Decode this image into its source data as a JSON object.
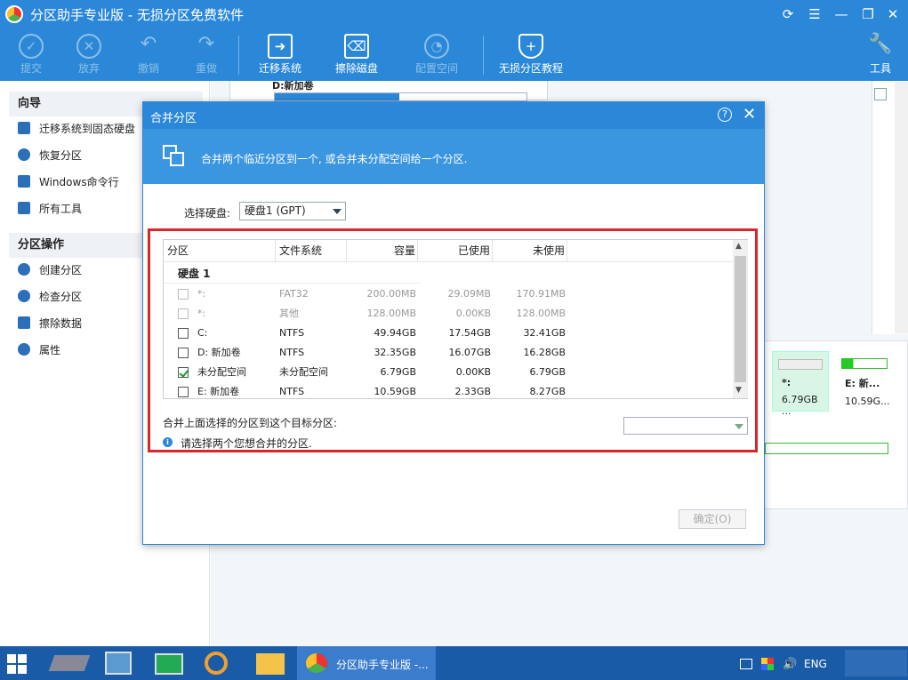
{
  "app": {
    "title": "分区助手专业版 - 无损分区免费软件"
  },
  "toolbar": {
    "items": [
      {
        "label": "提交",
        "icon": "check-icon",
        "disabled": true
      },
      {
        "label": "放弃",
        "icon": "cancel-circle-icon",
        "disabled": true
      },
      {
        "label": "撤销",
        "icon": "undo-icon",
        "disabled": true
      },
      {
        "label": "重做",
        "icon": "redo-icon",
        "disabled": true
      },
      {
        "label": "迁移系统",
        "icon": "migrate-icon",
        "disabled": false
      },
      {
        "label": "擦除磁盘",
        "icon": "wipe-disk-icon",
        "disabled": false
      },
      {
        "label": "配置空间",
        "icon": "allocate-icon",
        "disabled": true
      },
      {
        "label": "无损分区教程",
        "icon": "shield-icon",
        "disabled": false
      },
      {
        "label": "工具",
        "icon": "wrench-icon",
        "disabled": false
      }
    ]
  },
  "sidebar": {
    "wizard_title": "向导",
    "wizard_items": [
      "迁移系统到固态硬盘",
      "恢复分区",
      "Windows命令行",
      "所有工具"
    ],
    "ops_title": "分区操作",
    "ops_items": [
      "创建分区",
      "检查分区",
      "擦除数据",
      "属性"
    ]
  },
  "background": {
    "disk_label": "D:新加卷",
    "cards": [
      {
        "name": "*:",
        "size": "6.79GB ..."
      },
      {
        "name": "E: 新...",
        "size": "10.59G..."
      }
    ]
  },
  "dialog": {
    "title": "合并分区",
    "banner": "合并两个临近分区到一个, 或合并未分配空间给一个分区.",
    "select_disk_label": "选择硬盘:",
    "select_disk_value": "硬盘1 (GPT)",
    "columns": [
      "分区",
      "文件系统",
      "容量",
      "已使用",
      "未使用"
    ],
    "group": "硬盘 1",
    "rows": [
      {
        "name": "*:",
        "fs": "FAT32",
        "cap": "200.00MB",
        "used": "29.09MB",
        "free": "170.91MB",
        "checked": false,
        "disabled": true
      },
      {
        "name": "*:",
        "fs": "其他",
        "cap": "128.00MB",
        "used": "0.00KB",
        "free": "128.00MB",
        "checked": false,
        "disabled": true
      },
      {
        "name": "C:",
        "fs": "NTFS",
        "cap": "49.94GB",
        "used": "17.54GB",
        "free": "32.41GB",
        "checked": false,
        "disabled": false
      },
      {
        "name": "D:  新加卷",
        "fs": "NTFS",
        "cap": "32.35GB",
        "used": "16.07GB",
        "free": "16.28GB",
        "checked": false,
        "disabled": false
      },
      {
        "name": "未分配空间",
        "fs": "未分配空间",
        "cap": "6.79GB",
        "used": "0.00KB",
        "free": "6.79GB",
        "checked": true,
        "disabled": false
      },
      {
        "name": "E:  新加卷",
        "fs": "NTFS",
        "cap": "10.59GB",
        "used": "2.33GB",
        "free": "8.27GB",
        "checked": false,
        "disabled": false
      }
    ],
    "target_label": "合并上面选择的分区到这个目标分区:",
    "hint": "请选择两个您想合并的分区.",
    "ok_label": "确定(O)"
  },
  "taskbar": {
    "active_label": "分区助手专业版 -...",
    "lang": "ENG"
  }
}
